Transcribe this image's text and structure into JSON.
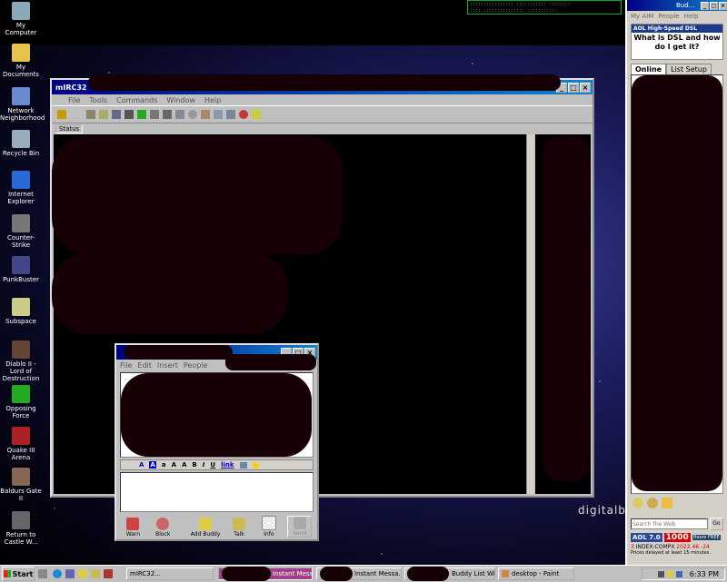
{
  "desktop": {
    "icons": [
      {
        "label": "My Computer",
        "color": "#8ab"
      },
      {
        "label": "My Documents",
        "color": "#e8c34a"
      },
      {
        "label": "Network Neighborhood",
        "color": "#6a8ad0"
      },
      {
        "label": "Recycle Bin",
        "color": "#9ab"
      },
      {
        "label": "Internet Explorer",
        "color": "#2a6ad8"
      },
      {
        "label": "Counter-Strike",
        "color": "#777"
      },
      {
        "label": "PunkBuster",
        "color": "#448"
      },
      {
        "label": "Subspace",
        "color": "#cc8"
      },
      {
        "label": "Diablo II - Lord of Destruction",
        "color": "#643"
      },
      {
        "label": "Opposing Force",
        "color": "#2a2"
      },
      {
        "label": "Quake III Arena",
        "color": "#a22"
      },
      {
        "label": "Baldurs Gate II",
        "color": "#865"
      },
      {
        "label": "Return to Castle W...",
        "color": "#666"
      }
    ],
    "watermark": "digitalbla"
  },
  "mirc": {
    "title": "mIRC32",
    "menus": [
      "File",
      "Tools",
      "Commands",
      "Window",
      "Help"
    ],
    "status_tab": "Status"
  },
  "im": {
    "menus": [
      "File",
      "Edit",
      "Insert",
      "People"
    ],
    "buttons": [
      "Warn",
      "Block",
      "Add Buddy",
      "Talk",
      "Info",
      "Send"
    ]
  },
  "aim": {
    "title_fragment": "Bud...",
    "menus": [
      "My AIM",
      "People",
      "Help"
    ],
    "ad_header": "AOL High-Speed DSL",
    "ad_text": "What is DSL and how do I get it?",
    "tabs": [
      "Online",
      "List Setup"
    ],
    "search_placeholder": "Search the Web",
    "go_label": "Go",
    "aol_badge": "AOL 7.0",
    "hours": "1000",
    "hours_label": "Hours FREE",
    "index_count": "3",
    "index_name": "INDEX:COMPX",
    "index_value": "2022.46",
    "index_change": "-24",
    "prices_note": "Prices delayed at least 15 minutes."
  },
  "taskbar": {
    "start": "Start",
    "tasks": [
      "mIRC32...",
      "Instant Mess...",
      "Instant Messa...",
      "Buddy List Wi...",
      "desktop - Paint"
    ],
    "clock": "6:33 PM"
  }
}
